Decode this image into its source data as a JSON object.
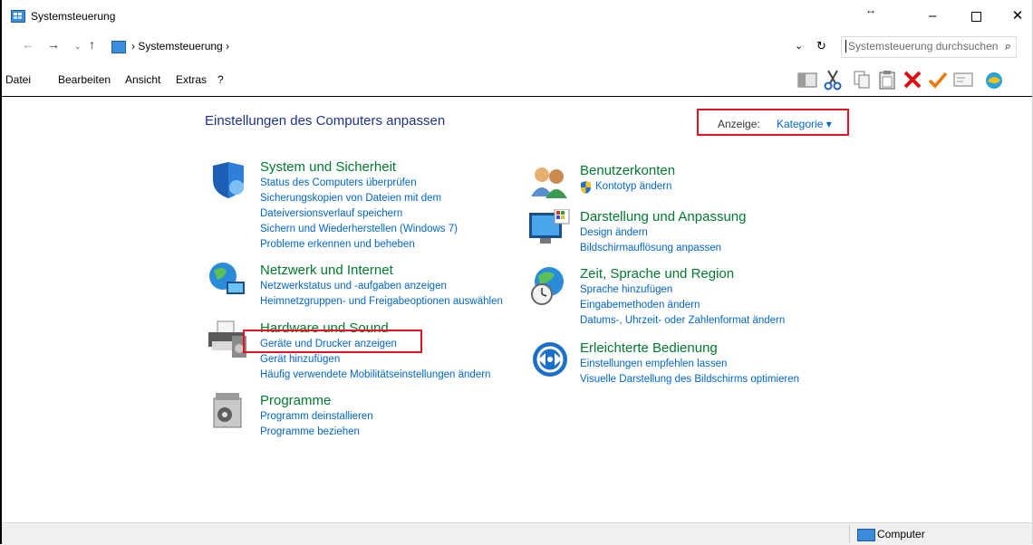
{
  "window": {
    "title": "Systemsteuerung",
    "resize_glyph": "↔",
    "min": "–",
    "close": "✕"
  },
  "nav": {
    "back": "←",
    "forward": "→",
    "dropdown": "⌄",
    "up": "↑",
    "breadcrumb": "›  Systemsteuerung  ›",
    "address_dropdown": "⌄",
    "refresh": "↻",
    "search_placeholder": "Systemsteuerung durchsuchen",
    "search_icon": "⌕"
  },
  "menu": [
    "Datei",
    "Bearbeiten",
    "Ansicht",
    "Extras",
    "?"
  ],
  "toolbar_icons": [
    "pane-icon",
    "cut-icon",
    "copy-icon",
    "paste-icon",
    "delete-icon",
    "check-icon",
    "properties-icon",
    "globe-icon"
  ],
  "main": {
    "title": "Einstellungen des Computers anpassen",
    "view_label": "Anzeige:",
    "view_value": "Kategorie ▾",
    "left": [
      {
        "heading": "System und Sicherheit",
        "links": [
          "Status des Computers überprüfen",
          "Sicherungskopien von Dateien mit dem",
          "Dateiversionsverlauf speichern",
          "Sichern und Wiederherstellen (Windows 7)",
          "Probleme erkennen und beheben"
        ]
      },
      {
        "heading": "Netzwerk und Internet",
        "links": [
          "Netzwerkstatus und -aufgaben anzeigen",
          "Heimnetzgruppen- und Freigabeoptionen auswählen"
        ]
      },
      {
        "heading": "Hardware und Sound",
        "links": [
          "Geräte und Drucker anzeigen",
          "Gerät hinzufügen",
          "Häufig verwendete Mobilitätseinstellungen ändern"
        ]
      },
      {
        "heading": "Programme",
        "links": [
          "Programm deinstallieren",
          "Programme beziehen"
        ]
      }
    ],
    "right": [
      {
        "heading": "Benutzerkonten",
        "links": [
          "Kontotyp ändern"
        ]
      },
      {
        "heading": "Darstellung und Anpassung",
        "links": [
          "Design ändern",
          "Bildschirmauflösung anpassen"
        ]
      },
      {
        "heading": "Zeit, Sprache und Region",
        "links": [
          "Sprache hinzufügen",
          "Eingabemethoden ändern",
          "Datums-, Uhrzeit- oder Zahlenformat ändern"
        ]
      },
      {
        "heading": "Erleichterte Bedienung",
        "links": [
          "Einstellungen empfehlen lassen",
          "Visuelle Darstellung des Bildschirms optimieren"
        ]
      }
    ]
  },
  "status": {
    "computer": "Computer"
  },
  "colors": {
    "heading": "#007a2e",
    "link": "#0066cc",
    "title": "#1e3287",
    "highlight": "#e81123"
  }
}
